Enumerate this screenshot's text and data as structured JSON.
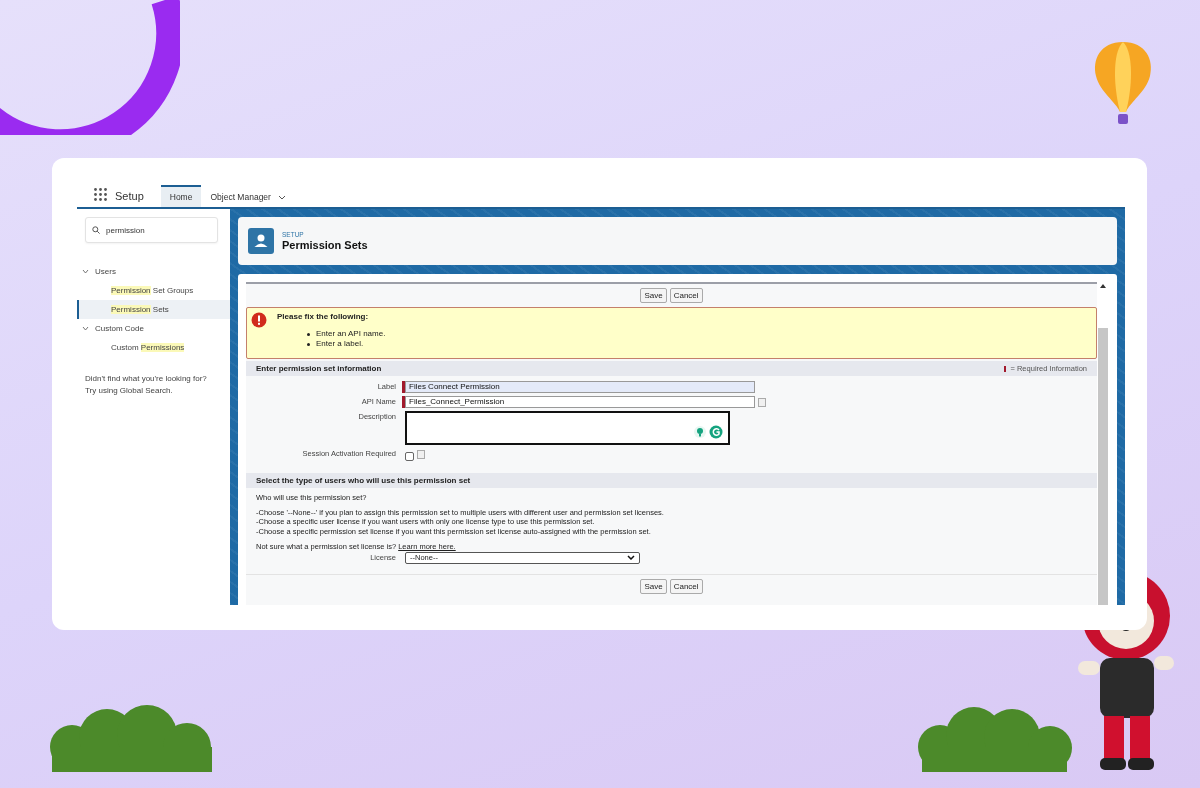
{
  "header": {
    "app_name": "Setup",
    "tabs": [
      {
        "label": "Home",
        "selected": true,
        "has_menu": false
      },
      {
        "label": "Object Manager",
        "selected": false,
        "has_menu": true
      }
    ]
  },
  "sidebar": {
    "search": {
      "value": "permission"
    },
    "tree": [
      {
        "label": "Users",
        "expanded": true,
        "children": [
          {
            "parts": [
              {
                "text": "Permission",
                "match": true
              },
              {
                "text": " Set Groups",
                "match": false
              }
            ],
            "selected": false
          },
          {
            "parts": [
              {
                "text": "Permission",
                "match": true
              },
              {
                "text": " Sets",
                "match": false
              }
            ],
            "selected": true
          }
        ]
      },
      {
        "label": "Custom Code",
        "expanded": true,
        "children": [
          {
            "parts": [
              {
                "text": "Custom ",
                "match": false
              },
              {
                "text": "Permissions",
                "match": true
              }
            ],
            "selected": false
          }
        ]
      }
    ],
    "help_text": [
      "Didn't find what you're looking for?",
      "Try using Global Search."
    ]
  },
  "page_header": {
    "breadcrumb": "SETUP",
    "title": "Permission Sets"
  },
  "form": {
    "top_buttons": [
      "Save",
      "Cancel"
    ],
    "error": {
      "title": "Please fix the following:",
      "items": [
        "Enter an API name.",
        "Enter a label."
      ]
    },
    "section_1": {
      "title": "Enter permission set information",
      "required_legend": "= Required Information",
      "fields": [
        {
          "kind": "text",
          "label": "Label",
          "value": "Files Connect Permission",
          "required": true,
          "info": false,
          "focused": true
        },
        {
          "kind": "text",
          "label": "API Name",
          "value": "Files_Connect_Permission",
          "required": true,
          "info": true,
          "focused": false
        },
        {
          "kind": "textarea",
          "label": "Description",
          "required": false,
          "info": false,
          "focused": false
        },
        {
          "kind": "checkbox",
          "label": "Session Activation Required",
          "checked": false,
          "required": false,
          "info": true,
          "focused": false
        }
      ]
    },
    "section_2": {
      "title": "Select the type of users who will use this permission set",
      "question": "Who will use this permission set?",
      "lines": [
        "-Choose '--None--' if you plan to assign this permission set to multiple users with different user and permission set licenses.",
        "-Choose a specific user license if you want users with only one license type to use this permission set.",
        "-Choose a specific permission set license if you want this permission set license auto-assigned with the permission set."
      ],
      "help": "Not sure what a permission set license is?",
      "link": "Learn more here.",
      "license_label": "License",
      "license_value": "--None--"
    },
    "bottom_buttons": [
      "Save",
      "Cancel"
    ]
  }
}
